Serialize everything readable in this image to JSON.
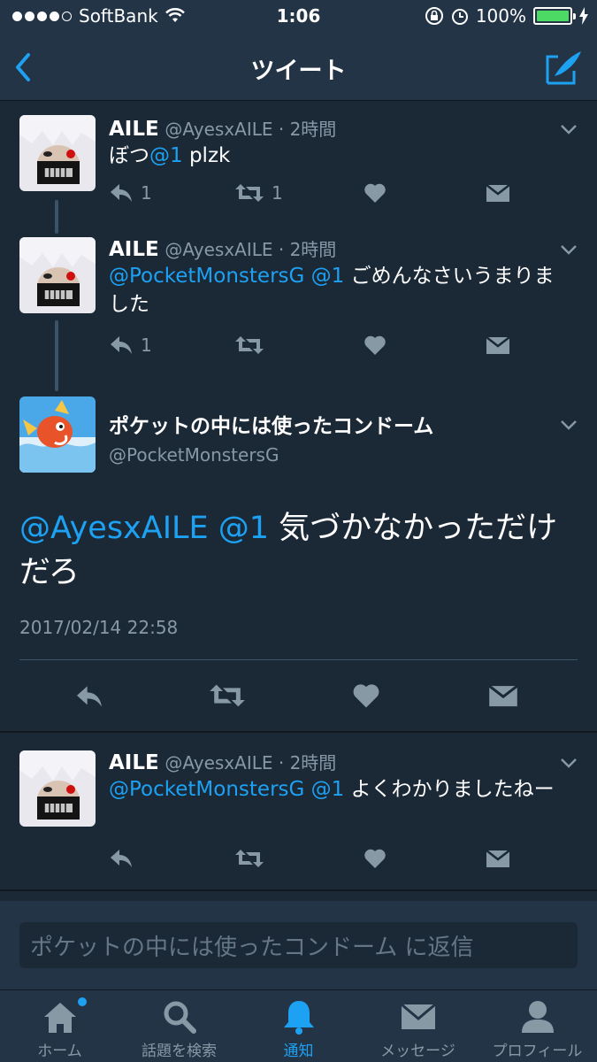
{
  "status_bar": {
    "carrier": "SoftBank",
    "time": "1:06",
    "battery": "100%",
    "signal_bars_filled": 4,
    "signal_bars_total": 5
  },
  "header": {
    "title": "ツイート"
  },
  "tweets": [
    {
      "name": "AILE",
      "handle": "@AyesxAILE · 2時間",
      "mention": "@1",
      "text": " plzk",
      "prefix": "ぼつ",
      "reply_count": "1",
      "retweet_count": "1"
    },
    {
      "name": "AILE",
      "handle": "@AyesxAILE · 2時間",
      "mention": "@PocketMonstersG @1",
      "text": " ごめんなさいうまりました",
      "reply_count": "1",
      "retweet_count": ""
    },
    {
      "name": "AILE",
      "handle": "@AyesxAILE · 2時間",
      "mention": "@PocketMonstersG @1",
      "text": " よくわかりましたねー",
      "reply_count": "",
      "retweet_count": ""
    }
  ],
  "focus": {
    "name": "ポケットの中には使ったコンドーム",
    "handle": "@PocketMonstersG",
    "mention": "@AyesxAILE @1",
    "text": " 気づかなかっただけだろ",
    "timestamp": "2017/02/14 22:58"
  },
  "reply": {
    "placeholder": "ポケットの中には使ったコンドーム に返信"
  },
  "tabs": [
    {
      "label": "ホーム",
      "icon": "home-icon"
    },
    {
      "label": "話題を検索",
      "icon": "search-icon"
    },
    {
      "label": "通知",
      "icon": "bell-icon"
    },
    {
      "label": "メッセージ",
      "icon": "mail-icon"
    },
    {
      "label": "プロフィール",
      "icon": "person-icon"
    }
  ],
  "colors": {
    "background": "#1b2836",
    "bar": "#243447",
    "accent": "#1da1f2",
    "muted": "#8899a6"
  }
}
